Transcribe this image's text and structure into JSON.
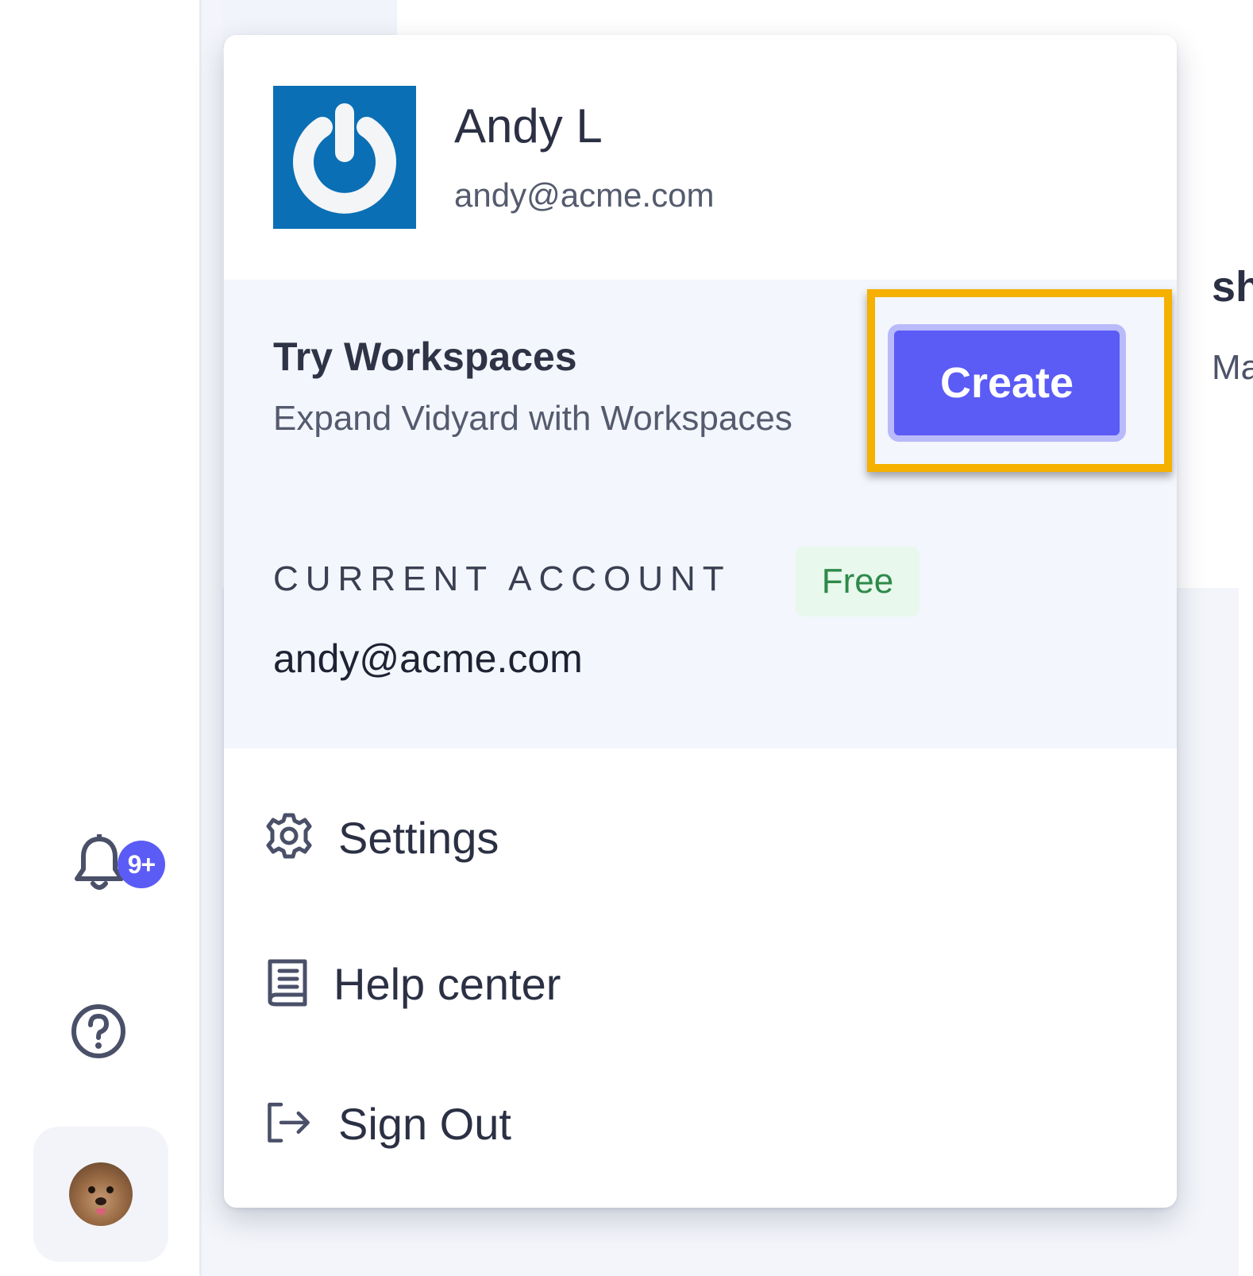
{
  "sidebar": {
    "notifications_badge": "9+",
    "icons": [
      "bell-icon",
      "help-circle-icon",
      "avatar"
    ]
  },
  "background": {
    "heading_fragment": "sh",
    "text_fragment": "Ma"
  },
  "menu": {
    "profile": {
      "name": "Andy L",
      "email": "andy@acme.com"
    },
    "workspaces": {
      "title": "Try Workspaces",
      "subtitle": "Expand Vidyard with Workspaces",
      "create_label": "Create"
    },
    "current_account": {
      "label": "CURRENT ACCOUNT",
      "plan": "Free",
      "email": "andy@acme.com"
    },
    "items": [
      {
        "label": "Settings",
        "icon": "gear-icon"
      },
      {
        "label": "Help center",
        "icon": "book-icon"
      },
      {
        "label": "Sign Out",
        "icon": "sign-out-icon"
      }
    ]
  },
  "colors": {
    "accent": "#5b5bf6",
    "highlight": "#f5b000",
    "logo_bg": "#0a6fb4",
    "free_badge_bg": "#e8f8ec",
    "free_badge_text": "#2e8a4a"
  }
}
